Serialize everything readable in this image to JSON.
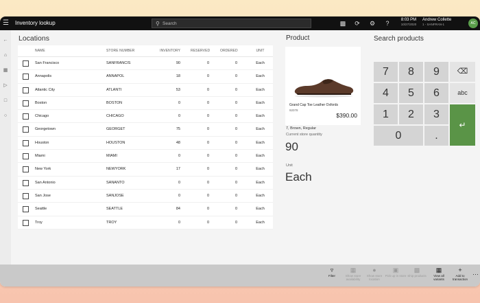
{
  "app": {
    "title": "Inventory lookup",
    "search_placeholder": "Search",
    "time": "8:03 PM",
    "date": "10/27/2020",
    "user_name": "Andrew Collette",
    "user_store": "1 - SANFRAN-1",
    "user_initials": "AC"
  },
  "locations": {
    "title": "Locations",
    "columns": [
      "NAME",
      "STORE NUMBER",
      "INVENTORY",
      "RESERVED",
      "ORDERED",
      "UNIT"
    ],
    "rows": [
      {
        "name": "San Francisco",
        "store": "SANFRANCIS",
        "inventory": "90",
        "reserved": "0",
        "ordered": "0",
        "unit": "Each"
      },
      {
        "name": "Annapolis",
        "store": "ANNAPOL",
        "inventory": "18",
        "reserved": "0",
        "ordered": "0",
        "unit": "Each"
      },
      {
        "name": "Atlantic City",
        "store": "ATLANTI",
        "inventory": "53",
        "reserved": "0",
        "ordered": "0",
        "unit": "Each"
      },
      {
        "name": "Boston",
        "store": "BOSTON",
        "inventory": "0",
        "reserved": "0",
        "ordered": "0",
        "unit": "Each"
      },
      {
        "name": "Chicago",
        "store": "CHICAGO",
        "inventory": "0",
        "reserved": "0",
        "ordered": "0",
        "unit": "Each"
      },
      {
        "name": "Georgetown",
        "store": "GEORGET",
        "inventory": "75",
        "reserved": "0",
        "ordered": "0",
        "unit": "Each"
      },
      {
        "name": "Houston",
        "store": "HOUSTON",
        "inventory": "48",
        "reserved": "0",
        "ordered": "0",
        "unit": "Each"
      },
      {
        "name": "Miami",
        "store": "MIAMI",
        "inventory": "0",
        "reserved": "0",
        "ordered": "0",
        "unit": "Each"
      },
      {
        "name": "New York",
        "store": "NEWYORK",
        "inventory": "17",
        "reserved": "0",
        "ordered": "0",
        "unit": "Each"
      },
      {
        "name": "San Antonio",
        "store": "SANANTO",
        "inventory": "0",
        "reserved": "0",
        "ordered": "0",
        "unit": "Each"
      },
      {
        "name": "San Jose",
        "store": "SANJOSE",
        "inventory": "0",
        "reserved": "0",
        "ordered": "0",
        "unit": "Each"
      },
      {
        "name": "Seattle",
        "store": "SEATTLE",
        "inventory": "84",
        "reserved": "0",
        "ordered": "0",
        "unit": "Each"
      },
      {
        "name": "Troy",
        "store": "TROY",
        "inventory": "0",
        "reserved": "0",
        "ordered": "0",
        "unit": "Each"
      }
    ]
  },
  "product": {
    "title": "Product",
    "name": "Grand Cap Toe Leather Oxfords",
    "sku": "92078",
    "price": "$390.00",
    "variant": "7, Brown, Regular",
    "current_store_quantity_label": "Current store quantity",
    "current_store_quantity": "90",
    "unit_label": "Unit",
    "unit": "Each"
  },
  "search_products": {
    "title": "Search products",
    "keys": [
      "7",
      "8",
      "9",
      "4",
      "5",
      "6",
      "abc",
      "1",
      "2",
      "3",
      "0",
      "."
    ]
  },
  "bottom_bar": [
    {
      "label": "Filter",
      "icon": "filter-icon",
      "enabled": true
    },
    {
      "label": "Show store availability",
      "icon": "store-icon",
      "enabled": false
    },
    {
      "label": "Show store location",
      "icon": "location-icon",
      "enabled": false
    },
    {
      "label": "Pick up in store",
      "icon": "pickup-icon",
      "enabled": false
    },
    {
      "label": "Ship products",
      "icon": "truck-icon",
      "enabled": false
    },
    {
      "label": "View all variants",
      "icon": "grid-icon",
      "enabled": true
    },
    {
      "label": "Add to transaction",
      "icon": "plus-icon",
      "enabled": true
    }
  ],
  "colors": {
    "topbar": "#111111",
    "accent_green": "#5a9447",
    "avatar": "#5a9e4b"
  }
}
